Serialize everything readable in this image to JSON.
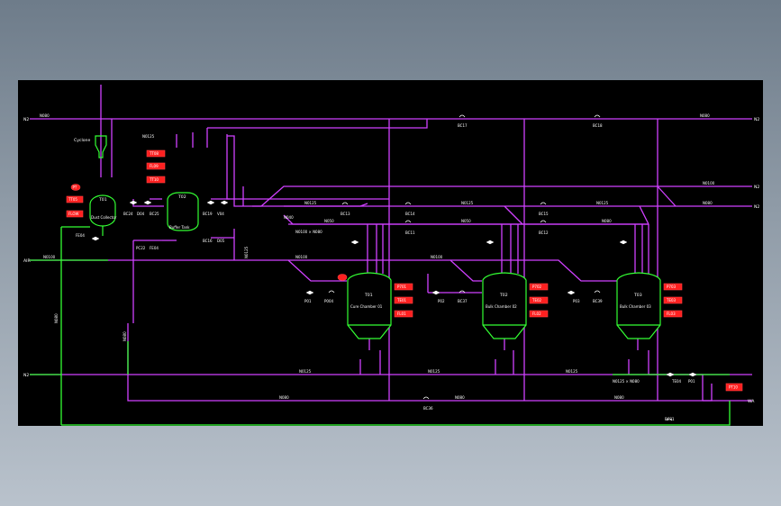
{
  "colors": {
    "background": "#000000",
    "process_line": "#d040ff",
    "utility_line": "#33ff33",
    "equipment": "#33ff33",
    "alarm": "#ff2020",
    "text": "#ffffff"
  },
  "streams": {
    "n2_top_left": "N2",
    "n2_top_right": "N2",
    "air_in_left": "AIR",
    "n2_right_1": "N2",
    "n2_right_2": "N2",
    "n2_left_mid": "N2",
    "n2_left_low": "N2",
    "wa_right": "WA"
  },
  "equipment": {
    "cyclone": "Cyclone",
    "dust_collector": "Dust Collector",
    "buffer_tank": "Buffer Tank",
    "chamber_1": "Cure Chamber 01",
    "chamber_2": "Bulk Chamber 02",
    "chamber_3": "Bulk Chamber 03"
  },
  "tags": {
    "dust_collector": "T01",
    "buffer_tank": "T02",
    "chamber_1": "T01",
    "chamber_2": "T02",
    "chamber_3": "T03"
  },
  "alarms": {
    "dc_top": "PT",
    "dc_1": "TT05",
    "dc_2": "FLOW",
    "bt_1": "TT08",
    "bt_2": "FL09",
    "bt_3": "TT10",
    "ch1_1": "P701",
    "ch1_2": "TE01",
    "ch1_3": "FL01",
    "ch2_1": "P702",
    "ch2_2": "TE02",
    "ch2_3": "FL02",
    "ch3_1": "P703",
    "ch3_2": "TE03",
    "ch3_3": "FL03",
    "outlet": "PT10"
  },
  "line_labels": {
    "top_header": "N080",
    "top_right": "N080",
    "right_1": "N0100",
    "right_2": "N080",
    "mid_header_1": "N0125",
    "mid_header_2": "N0125",
    "mid_header_3": "N0125",
    "n050_1": "N050",
    "n050_2": "N050",
    "n050_3": "N080",
    "bottom_1": "N0125",
    "bottom_2": "N0125",
    "bottom_3": "N0125",
    "bottom_line": "N080",
    "bottom_line_2": "N080",
    "bottom_line_3": "N080",
    "utility_low": "N0100",
    "feed_line": "N0100",
    "feed_line_2": "N0100",
    "mix_1": "N040",
    "mix_2": "N0100 × N080",
    "mix_3": "N0125 × N080",
    "vert_left": "N080",
    "vert_mid": "N080",
    "vert_top": "N0125",
    "vert_bt": "N0125"
  },
  "valves": {
    "v_top_1": "BC17",
    "v_top_2": "BC18",
    "v_a1": "BC24",
    "v_a2": "D04",
    "v_a3": "BC25",
    "v_b1": "BC19",
    "v_b2": "V04",
    "v_b3": "BC16",
    "v_b4": "D05",
    "v_c1": "BC13",
    "v_c2": "BC14",
    "v_c3": "BC11",
    "v_c4": "BC12",
    "v_c5": "BC15",
    "v_d1": "P01",
    "v_d2": "P004",
    "v_d3": "P02",
    "v_d4": "BC37",
    "v_d5": "P03",
    "v_d6": "BC39",
    "v_e1": "BC36",
    "v_e2": "BC31",
    "v_e3": "P01",
    "v_e4": "TE04",
    "v_f1": "FE04",
    "v_f2": "PC22",
    "v_f3": "FE04"
  }
}
